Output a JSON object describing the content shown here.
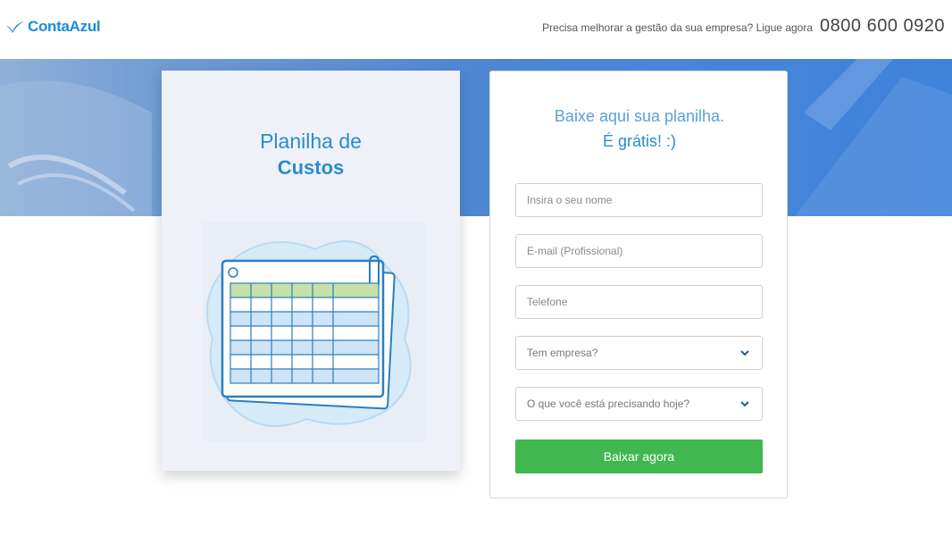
{
  "brand": {
    "name": "ContaAzul",
    "color": "#1a8cd8"
  },
  "header": {
    "cta_text": "Precisa melhorar a gestão da sua empresa? Ligue agora",
    "phone": "0800 600 0920"
  },
  "product": {
    "title_line1": "Planilha de",
    "title_line2": "Custos",
    "illustration_icon": "spreadsheet-icon"
  },
  "form": {
    "heading_line1": "Baixe aqui sua planilha.",
    "heading_line2": "É grátis! :)",
    "name_placeholder": "Insira o seu nome",
    "email_placeholder": "E-mail (Profissional)",
    "phone_placeholder": "Telefone",
    "company_select": "Tem empresa?",
    "need_select": "O que você está precisando hoje?",
    "submit_label": "Baixar agora"
  },
  "colors": {
    "accent": "#2a8ccc",
    "submit": "#40b84f",
    "hero": "#4f86d0"
  }
}
